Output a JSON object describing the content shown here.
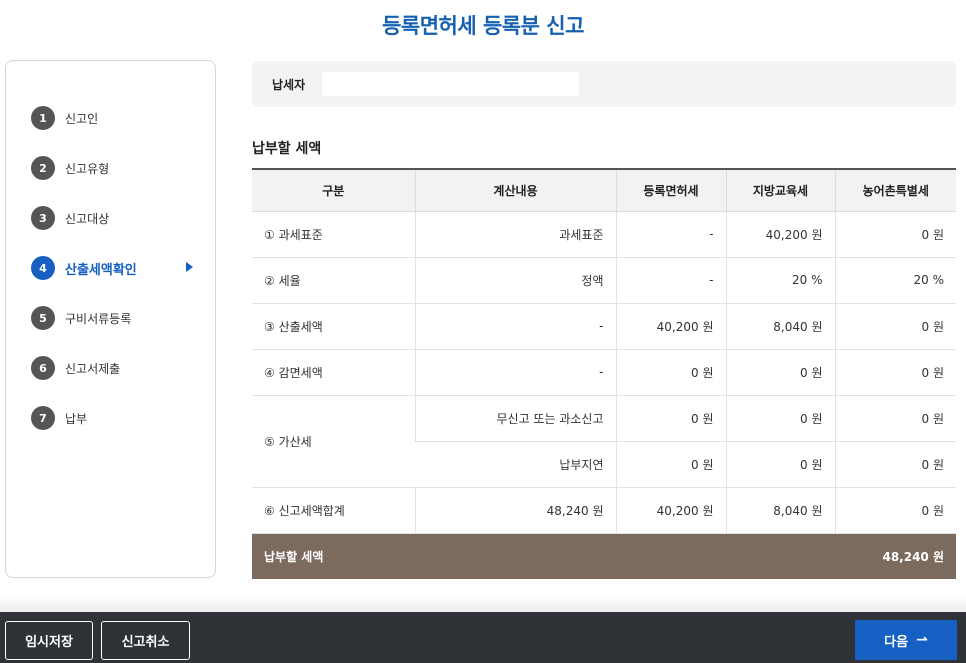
{
  "page": {
    "title": "등록면허세 등록분 신고"
  },
  "steps": [
    {
      "num": "1",
      "label": "신고인"
    },
    {
      "num": "2",
      "label": "신고유형"
    },
    {
      "num": "3",
      "label": "신고대상"
    },
    {
      "num": "4",
      "label": "산출세액확인"
    },
    {
      "num": "5",
      "label": "구비서류등록"
    },
    {
      "num": "6",
      "label": "신고서제출"
    },
    {
      "num": "7",
      "label": "납부"
    }
  ],
  "taxpayer": {
    "label": "납세자",
    "value": ""
  },
  "section": {
    "title": "납부할 세액"
  },
  "table": {
    "headers": [
      "구분",
      "계산내용",
      "등록면허세",
      "지방교육세",
      "농어촌특별세"
    ],
    "rows": [
      {
        "item": "① 과세표준",
        "calc": "과세표준",
        "reg": "-",
        "edu": "40,200 원",
        "rural": "0 원"
      },
      {
        "item": "② 세율",
        "calc": "정액",
        "reg": "-",
        "edu": "20 %",
        "rural": "20 %"
      },
      {
        "item": "③ 산출세액",
        "calc": "-",
        "reg": "40,200 원",
        "edu": "8,040 원",
        "rural": "0 원"
      },
      {
        "item": "④ 감면세액",
        "calc": "-",
        "reg": "0 원",
        "edu": "0 원",
        "rural": "0 원"
      }
    ],
    "penalty": {
      "item": "⑤ 가산세",
      "sub": [
        {
          "calc": "무신고 또는 과소신고",
          "reg": "0 원",
          "edu": "0 원",
          "rural": "0 원"
        },
        {
          "calc": "납부지연",
          "reg": "0 원",
          "edu": "0 원",
          "rural": "0 원"
        }
      ]
    },
    "sum_row": {
      "item": "⑥ 신고세액합계",
      "calc": "48,240 원",
      "reg": "40,200 원",
      "edu": "8,040 원",
      "rural": "0 원"
    },
    "total": {
      "label": "납부할 세액",
      "value": "48,240 원"
    }
  },
  "footer": {
    "save_label": "임시저장",
    "cancel_label": "신고취소",
    "next_label": "다음",
    "next_icon": "arrow-right-icon"
  },
  "colors": {
    "accent": "#1660c4",
    "title": "#1560b0",
    "total_bg": "#7d6a5e",
    "footer_bg": "#2f3237"
  }
}
